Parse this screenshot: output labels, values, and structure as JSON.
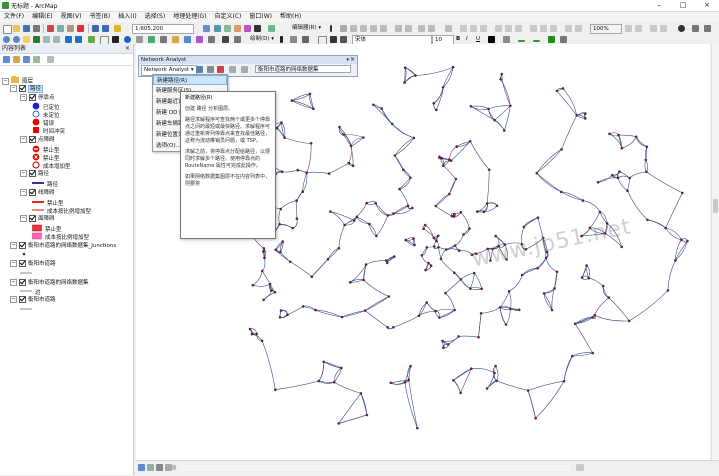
{
  "window": {
    "title": "无标题 - ArcMap"
  },
  "menubar": [
    "文件(F)",
    "编辑(E)",
    "视图(V)",
    "书签(B)",
    "插入(I)",
    "选择(S)",
    "地理处理(G)",
    "自定义(C)",
    "窗口(W)",
    "帮助(H)"
  ],
  "toolbar": {
    "scale": "1:605,200",
    "editor": "编辑器(R) ▾",
    "drawing": "绘制(D) ▾",
    "font_name": "宋体",
    "font_size": "10",
    "bold": "B",
    "italic": "I",
    "underline": "U",
    "zoom": "100%"
  },
  "toc": {
    "title": "内容列表",
    "close": "×",
    "items": [
      {
        "label": "图层",
        "level": 0,
        "type": "group",
        "checked": true
      },
      {
        "label": "路径",
        "level": 1,
        "type": "layer",
        "checked": true,
        "selected": true
      },
      {
        "label": "停靠点",
        "level": 2,
        "type": "layer",
        "checked": true
      },
      {
        "label": "已定位",
        "level": 3,
        "type": "legend",
        "symbol": "circle-blue"
      },
      {
        "label": "未定位",
        "level": 3,
        "type": "legend",
        "symbol": "circle-outline"
      },
      {
        "label": "错误",
        "level": 3,
        "type": "legend",
        "symbol": "circle-red"
      },
      {
        "label": "时间冲突",
        "level": 3,
        "type": "legend",
        "symbol": "square-red"
      },
      {
        "label": "点障碍",
        "level": 2,
        "type": "layer",
        "checked": true
      },
      {
        "label": "禁止型",
        "level": 3,
        "type": "legend",
        "symbol": "barrier-restrict"
      },
      {
        "label": "禁止型",
        "level": 3,
        "type": "legend",
        "symbol": "barrier-x"
      },
      {
        "label": "成本增加型",
        "level": 3,
        "type": "legend",
        "symbol": "barrier-cost"
      },
      {
        "label": "路径",
        "level": 2,
        "type": "layer",
        "checked": true
      },
      {
        "label": "路径",
        "level": 3,
        "type": "legend",
        "symbol": "line-navy"
      },
      {
        "label": "线障碍",
        "level": 2,
        "type": "layer",
        "checked": true
      },
      {
        "label": "禁止型",
        "level": 3,
        "type": "legend",
        "symbol": "line-red"
      },
      {
        "label": "成本按比例增加型",
        "level": 3,
        "type": "legend",
        "symbol": "line-red-thin"
      },
      {
        "label": "面障碍",
        "level": 2,
        "type": "layer",
        "checked": true
      },
      {
        "label": "禁止型",
        "level": 3,
        "type": "legend",
        "symbol": "poly-red"
      },
      {
        "label": "成本按比例增加型",
        "level": 3,
        "type": "legend",
        "symbol": "poly-pink"
      },
      {
        "label": "衡阳市道路的网络数据集_Junctions",
        "level": 1,
        "type": "layer",
        "checked": true
      },
      {
        "label": "",
        "level": 2,
        "type": "legend",
        "symbol": "dot-small"
      },
      {
        "label": "衡阳市道路",
        "level": 1,
        "type": "layer",
        "checked": true
      },
      {
        "label": "",
        "level": 2,
        "type": "legend",
        "symbol": "line-gray"
      },
      {
        "label": "衡阳市道路的网络数据集",
        "level": 1,
        "type": "layer",
        "checked": true
      },
      {
        "label": "边",
        "level": 2,
        "type": "legend",
        "symbol": "line-gray"
      },
      {
        "label": "衡阳市道路",
        "level": 1,
        "type": "layer",
        "checked": true
      },
      {
        "label": "",
        "level": 2,
        "type": "legend",
        "symbol": "line-gray"
      }
    ]
  },
  "network_analyst": {
    "title": "Network Analyst",
    "dropdown": "Network Analyst ▾",
    "dataset": "衡阳市道路的网络数据集",
    "menu": [
      {
        "label": "新建路径(R)",
        "selected": true
      },
      {
        "label": "新建服务区(S)"
      },
      {
        "label": "新建最近设施点(C)"
      },
      {
        "label": "新建 OD 成本矩阵(M)"
      },
      {
        "label": "新建车辆路径派发(V)"
      },
      {
        "label": "新建位置分配(L)"
      },
      {
        "label": "选项(O)..."
      }
    ]
  },
  "tooltip": {
    "heading": "新建路径(R)",
    "p1": "创建 路径 分析图层。",
    "p2": "路径求解程序可查找两个或更多个停靠点之间的最短或最快路径。求解程序可通过重新排列停靠点来查找最佳路径，这称为流动推销员问题，或 TSP。",
    "p3": "求解之前，将停靠点分配给路径，以便同时求解多个路径。使用停靠点的 RouteName 属性可完成此操作。",
    "p4": "如果网络数据集图层不在内容列表中，则要将"
  },
  "map": {
    "watermark": "www.jb51.net"
  },
  "colors": {
    "roads": "#3b4a86",
    "junctions": "#6b1e3a",
    "selection": "#cce4f7"
  }
}
